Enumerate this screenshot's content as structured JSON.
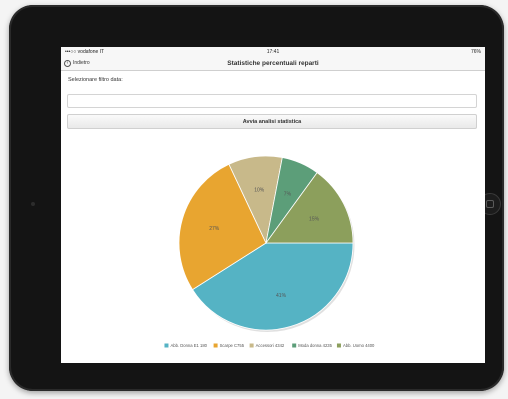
{
  "status_bar": {
    "carrier": "•••○○ vodafone IT",
    "time": "17:41",
    "battery": "76%"
  },
  "nav": {
    "back_label": "Indietro",
    "title": "Statistiche percentuali reparti"
  },
  "filter": {
    "label": "Selezionare filtro data:",
    "value": "",
    "placeholder": ""
  },
  "run_button": "Avvia analisi statistica",
  "chart_data": {
    "type": "pie",
    "slices": [
      {
        "label": "Abb. Donna E1 180",
        "value": 41,
        "display": "41%",
        "color": "#55b3c4"
      },
      {
        "label": "Scarpe C755",
        "value": 27,
        "display": "27%",
        "color": "#e8a530"
      },
      {
        "label": "Accessori 4342",
        "value": 10,
        "display": "10%",
        "color": "#c8b98a"
      },
      {
        "label": "Moda donna 4235",
        "value": 7,
        "display": "7%",
        "color": "#5c9e79"
      },
      {
        "label": "Abb. Uomo 4400",
        "value": 15,
        "display": "15%",
        "color": "#8c9f5c"
      }
    ],
    "legend_position": "bottom"
  }
}
